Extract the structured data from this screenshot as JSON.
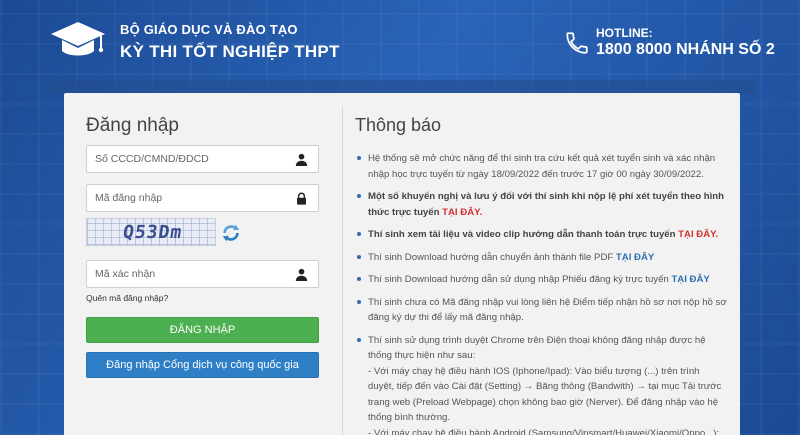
{
  "header": {
    "org": "BỘ GIÁO DỤC VÀ ĐÀO TẠO",
    "exam": "KỲ THI TỐT NGHIỆP THPT",
    "hotline_label": "HOTLINE:",
    "hotline_number": "1800 8000 NHÁNH SỐ 2"
  },
  "login": {
    "title": "Đăng nhập",
    "id_placeholder": "Số CCCD/CMND/ĐDCD",
    "password_placeholder": "Mã đăng nhập",
    "captcha_text": "Q53Dm",
    "captcha_input_placeholder": "Mã xác nhận",
    "forgot_link": "Quên mã đăng nhập?",
    "login_button": "ĐĂNG NHẬP",
    "gov_button": "Đăng nhập Cổng dịch vụ công quốc gia"
  },
  "notices": {
    "title": "Thông báo",
    "items": [
      {
        "text1": "Hệ thống sẽ mở chức năng để thí sinh tra cứu kết quả xét tuyển sinh và xác nhận nhập học trực tuyến từ ngày 18/09/2022 đến trước 17 giờ 00 ngày 30/09/2022."
      },
      {
        "text1": "Một số khuyến nghị và lưu ý đối với thí sinh khi nộp lệ phí xét tuyển theo hình thức trực tuyến ",
        "link": "TẠI ĐÂY."
      },
      {
        "text1": "Thí sinh xem tài liệu và video clip hướng dẫn thanh toán trực tuyến ",
        "link": "TẠI ĐÂY."
      },
      {
        "text1": "Thí sinh Download hướng dẫn chuyển ảnh thành file PDF ",
        "link": "TẠI ĐÂY"
      },
      {
        "text1": "Thí sinh Download hướng dẫn sử dụng nhập Phiếu đăng ký trực tuyến ",
        "link": "TẠI ĐÂY"
      },
      {
        "text1": "Thí sinh chưa có Mã đăng nhập vui lòng liên hệ Điểm tiếp nhận hồ sơ nơi nộp hồ sơ đăng ký dự thi để lấy mã đăng nhập."
      },
      {
        "text1": "Thí sinh sử dụng trình duyệt Chrome trên Điện thoại không đăng nhập được hệ thống thực hiện như sau:",
        "sub1": " - Với máy chạy hệ điều hành IOS (Iphone/Ipad): Vào biểu tượng (...) trên trình duyệt, tiếp đến vào Cài đặt (Setting) → Băng thông (Bandwith) → tại mục Tải trước trang web (Preload Webpage) chọn không bao giờ (Nerver). Để đăng nhập vào hệ thống bình thường.",
        "sub2": " - Với máy chạy hệ điều hành Android (Samsung/Vinsmart/Huawei/Xiaomi/Oppo...):"
      }
    ]
  }
}
